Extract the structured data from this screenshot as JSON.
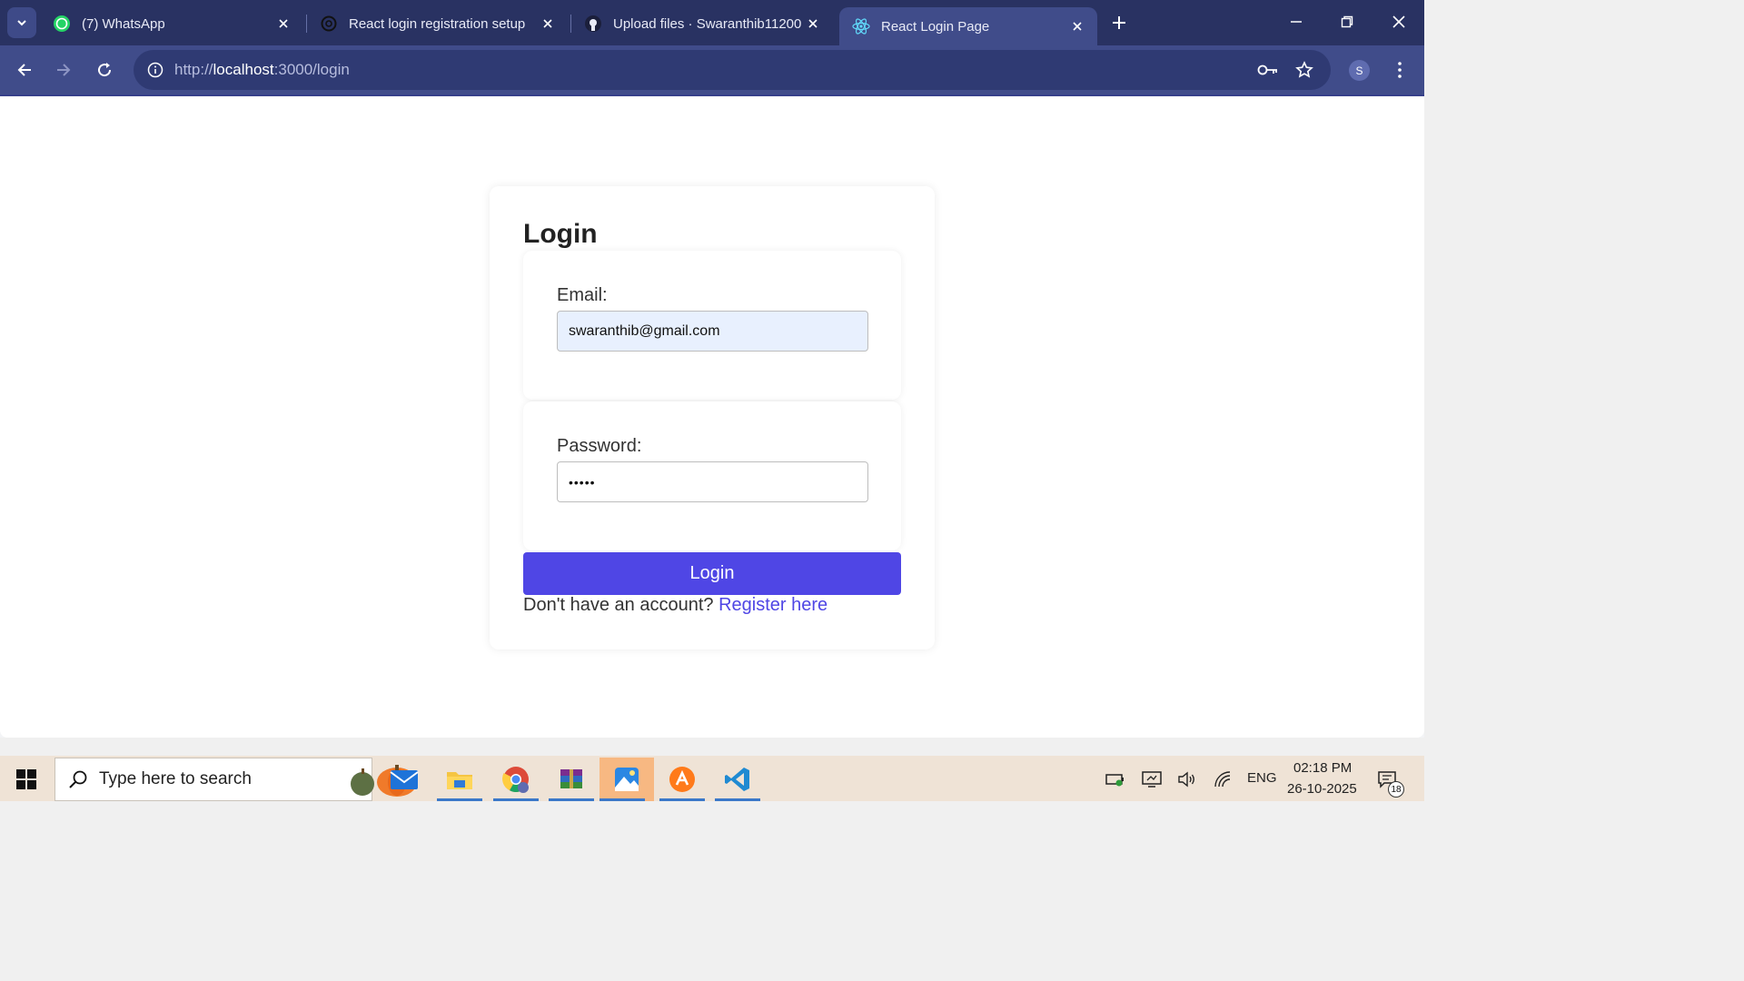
{
  "tabs": [
    {
      "title": "(7) WhatsApp",
      "icon": "whatsapp-icon"
    },
    {
      "title": "React login registration setup",
      "icon": "chatgpt-icon"
    },
    {
      "title": "Upload files · Swaranthib11200",
      "icon": "github-icon"
    },
    {
      "title": "React Login Page",
      "icon": "react-icon",
      "active": true
    }
  ],
  "address": {
    "scheme": "http://",
    "host": "localhost",
    "rest": ":3000/login"
  },
  "profile_initial": "S",
  "login": {
    "heading": "Login",
    "email_label": "Email:",
    "email_value": "swaranthib@gmail.com",
    "password_label": "Password:",
    "password_masked": "•••••",
    "submit_label": "Login",
    "register_prompt": "Don't have an account?",
    "register_link": "Register here"
  },
  "taskbar": {
    "search_placeholder": "Type here to search",
    "apps": [
      "mail-icon",
      "file-explorer-icon",
      "chrome-icon",
      "winrar-icon",
      "photos-icon",
      "avast-icon",
      "vscode-icon"
    ],
    "lang": "ENG",
    "time": "02:18 PM",
    "date": "26-10-2025",
    "notification_count": "18"
  },
  "colors": {
    "accent": "#4f46e5",
    "chrome_dark": "#293262",
    "chrome_toolbar": "#404c8a"
  }
}
